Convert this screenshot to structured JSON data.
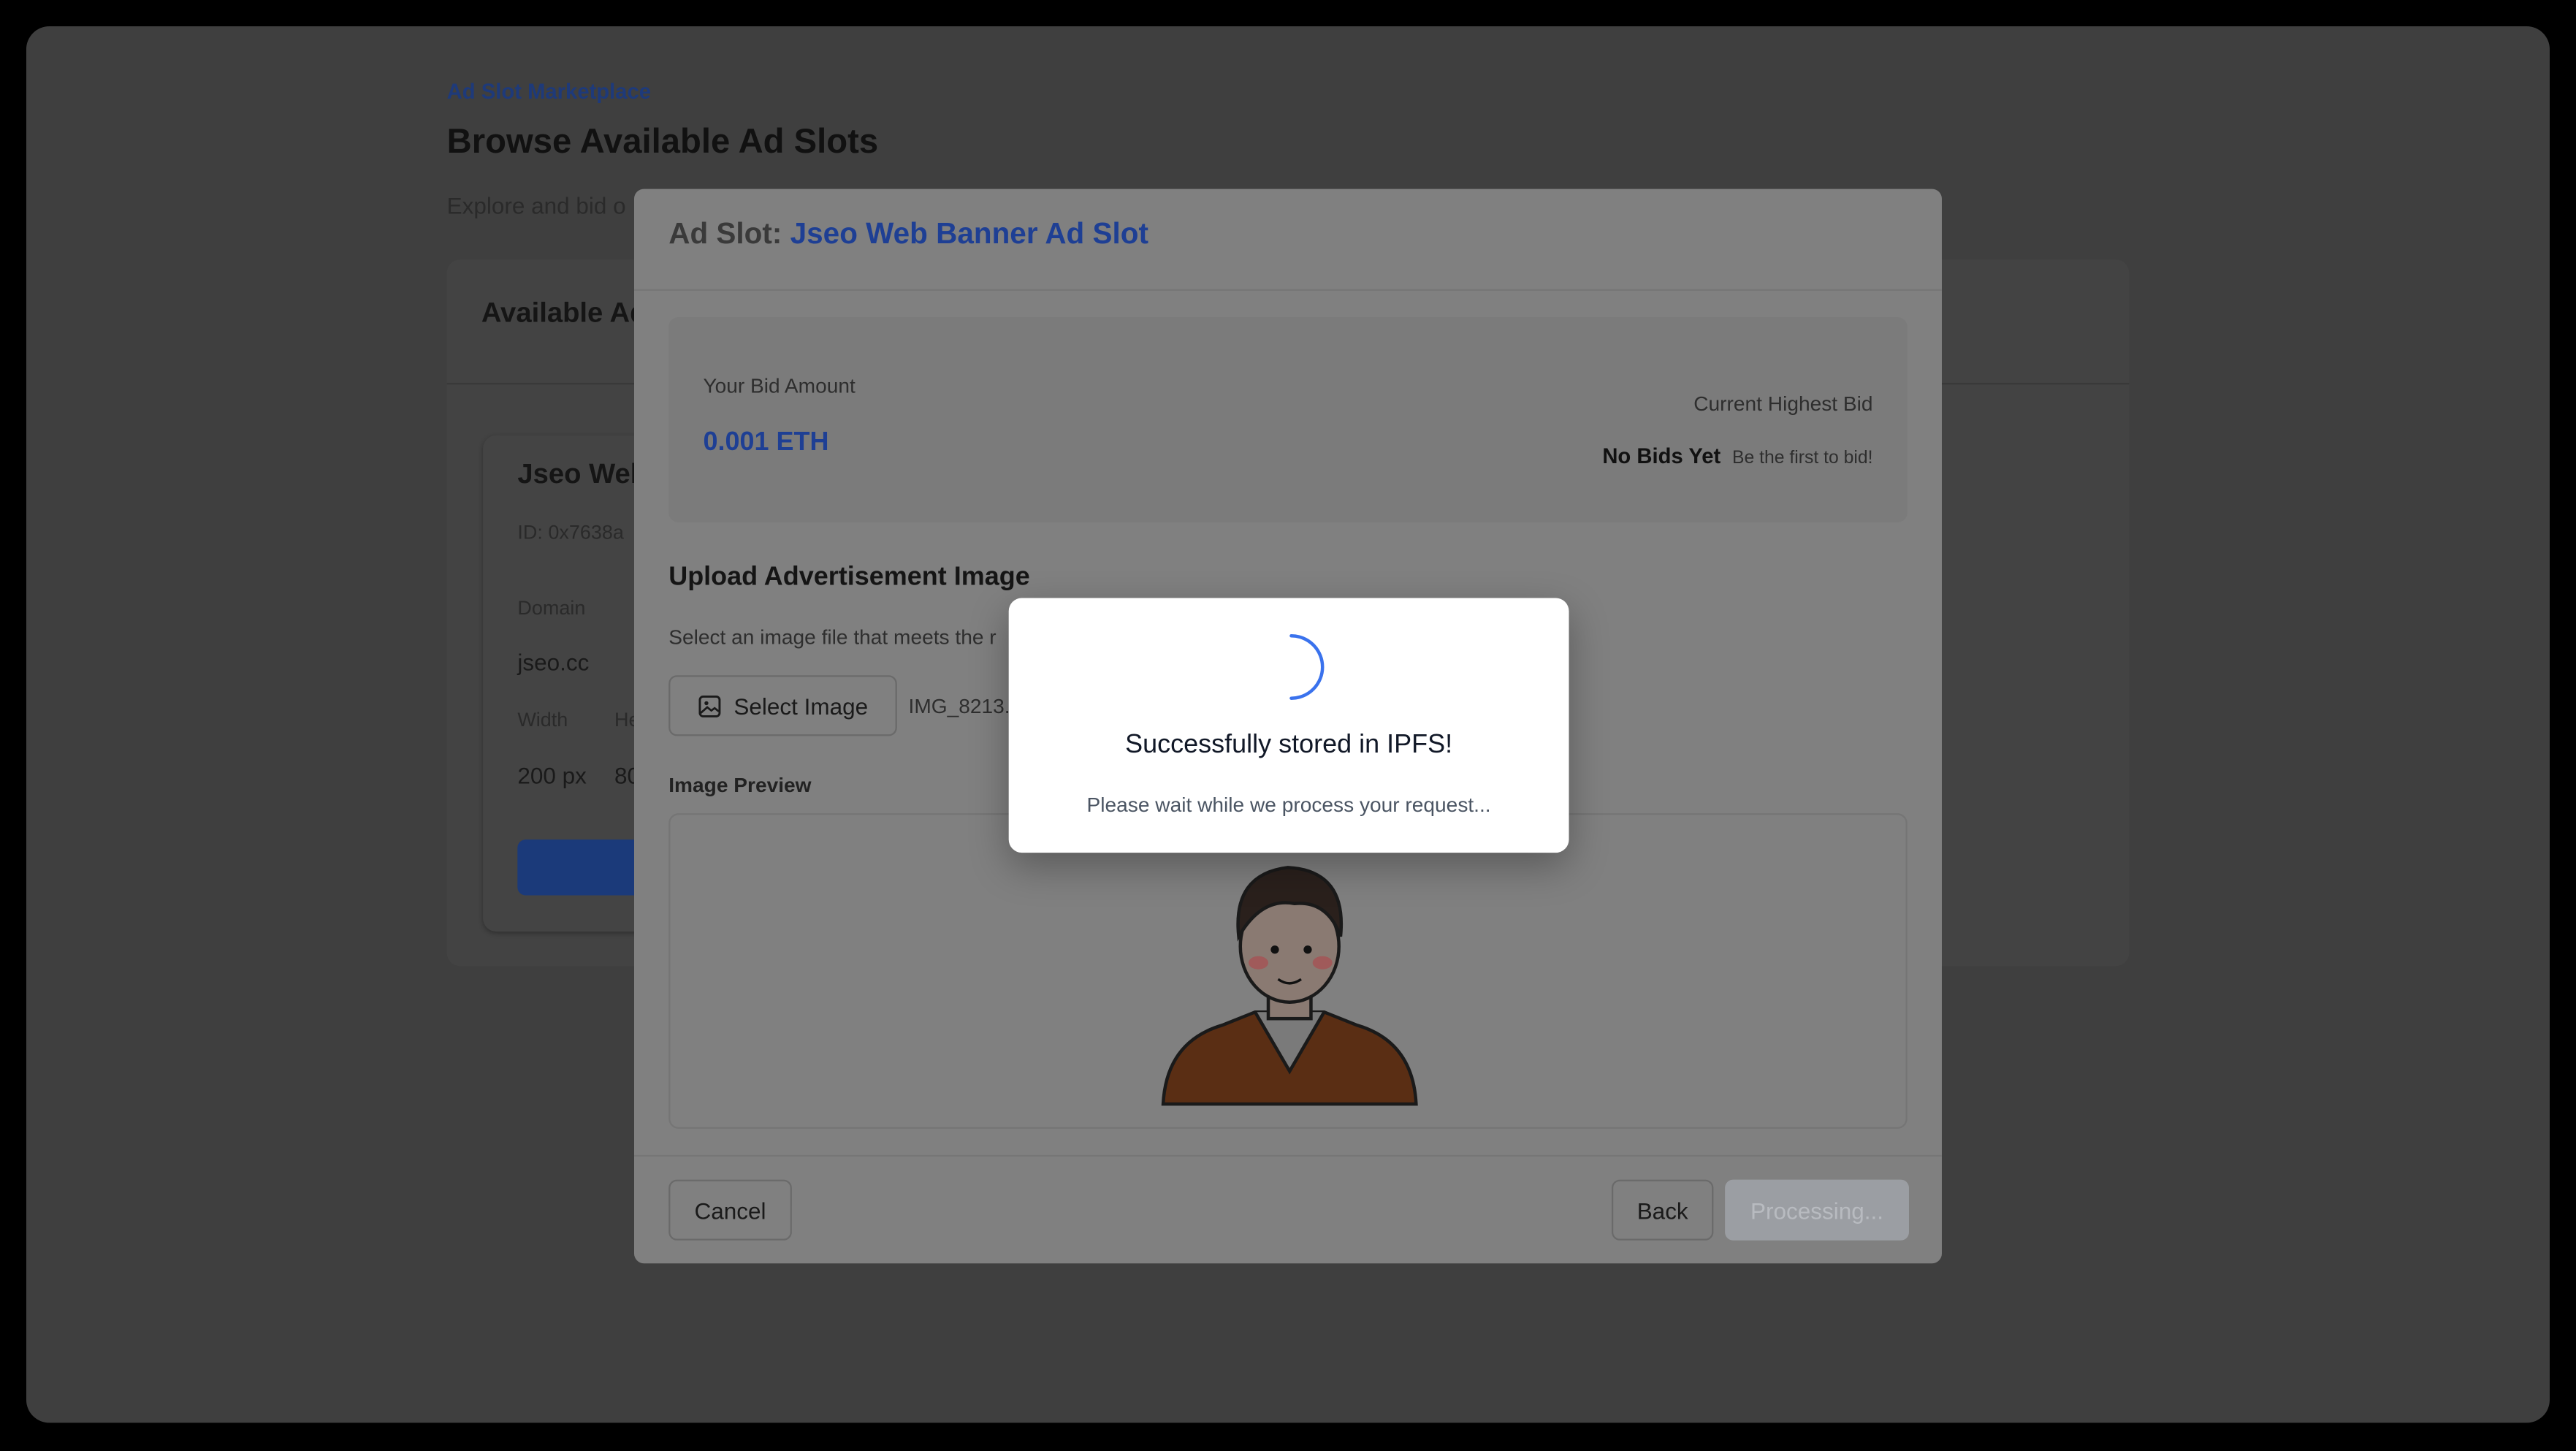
{
  "page": {
    "breadcrumb": "Ad Slot Marketplace",
    "title": "Browse Available Ad Slots",
    "subtitle": "Explore and bid o",
    "card_heading": "Available Ad",
    "slot_card": {
      "name": "Jseo Wel",
      "id": "ID: 0x7638a",
      "domain_label": "Domain",
      "domain_value": "jseo.cc",
      "width_label": "Width",
      "height_label": "He",
      "width_value": "200 px",
      "height_value": "80"
    }
  },
  "modal": {
    "title_prefix": "Ad Slot:",
    "title_name": "Jseo Web Banner Ad Slot",
    "bid_label": "Your Bid Amount",
    "bid_value": "0.001 ETH",
    "highest_label": "Current Highest Bid",
    "highest_value": "No Bids Yet",
    "highest_note": "Be the first to bid!",
    "upload_heading": "Upload Advertisement Image",
    "upload_hint": "Select an image file that meets the r",
    "select_button": "Select Image",
    "file_name": "IMG_8213.",
    "preview_label": "Image Preview",
    "cancel": "Cancel",
    "back": "Back",
    "processing": "Processing..."
  },
  "loader": {
    "title": "Successfully stored in IPFS!",
    "message": "Please wait while we process your request..."
  },
  "colors": {
    "accent": "#2563eb",
    "overlay": "#000000"
  }
}
